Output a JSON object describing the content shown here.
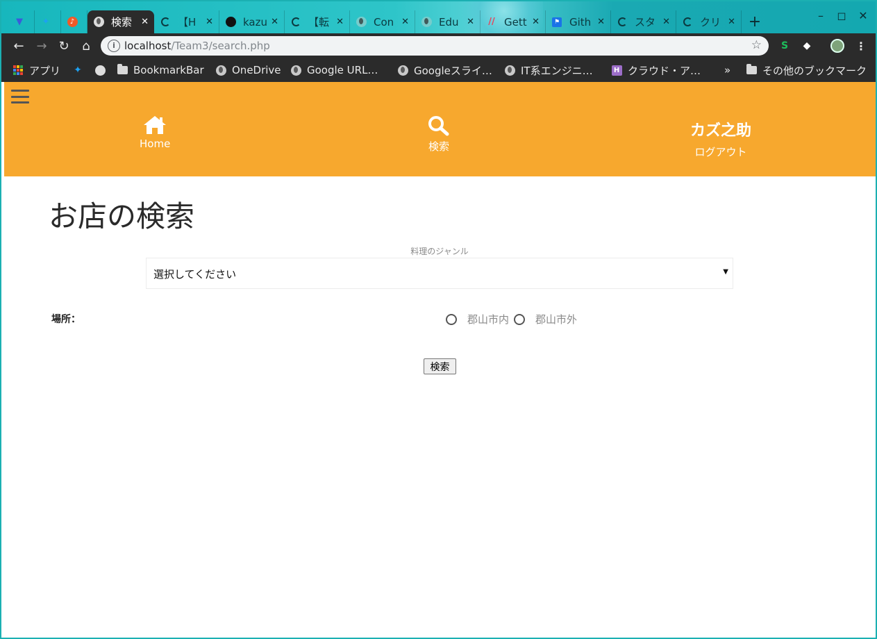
{
  "browser": {
    "tabs": [
      {
        "title": "",
        "icon": "vpn-shield-icon",
        "color": "#3b5bdb"
      },
      {
        "title": "",
        "icon": "twitter-bird-icon",
        "color": "#1da1f2"
      },
      {
        "title": "",
        "icon": "music-note-icon",
        "color": "#f05a28"
      },
      {
        "title": "検索",
        "icon": "globe-icon",
        "active": true
      },
      {
        "title": "【H",
        "icon": "loading-spinner-icon"
      },
      {
        "title": "kazu",
        "icon": "github-icon"
      },
      {
        "title": "【転",
        "icon": "loading-spinner-icon"
      },
      {
        "title": "Con",
        "icon": "globe-icon"
      },
      {
        "title": "Edu",
        "icon": "globe-icon"
      },
      {
        "title": "Gett",
        "icon": "stripes-icon",
        "color": "#e8435a"
      },
      {
        "title": "Gith",
        "icon": "flag-icon",
        "color": "#1a73e8"
      },
      {
        "title": "スタ",
        "icon": "loading-spinner-icon"
      },
      {
        "title": "クリ",
        "icon": "loading-spinner-icon"
      }
    ],
    "new_tab": "+",
    "url": {
      "host": "localhost",
      "path": "/Team3/search.php"
    },
    "bookmarks": [
      {
        "label": "アプリ",
        "icon": "apps-grid-icon"
      },
      {
        "label": "",
        "icon": "twitter-bird-icon"
      },
      {
        "label": "",
        "icon": "github-icon"
      },
      {
        "label": "BookmarkBar",
        "icon": "folder-icon"
      },
      {
        "label": "OneDrive",
        "icon": "globe-icon"
      },
      {
        "label": "Google URL…",
        "icon": "globe-icon"
      },
      {
        "label": "Googleスライ…",
        "icon": "globe-icon"
      },
      {
        "label": "IT系エンジニ…",
        "icon": "globe-icon"
      },
      {
        "label": "クラウド・ア…",
        "icon": "heroku-icon"
      }
    ],
    "overflow": "»",
    "other_bookmarks": "その他のブックマーク"
  },
  "header": {
    "home_label": "Home",
    "search_label": "検索",
    "user_name": "カズ之助",
    "logout_label": "ログアウト",
    "bg_color": "#f7a82e"
  },
  "main": {
    "title": "お店の検索",
    "genre_label": "料理のジャンル",
    "genre_selected": "選択してください",
    "place_label": "場所：",
    "place_options": [
      "郡山市内",
      "郡山市外"
    ],
    "search_button": "検索"
  }
}
